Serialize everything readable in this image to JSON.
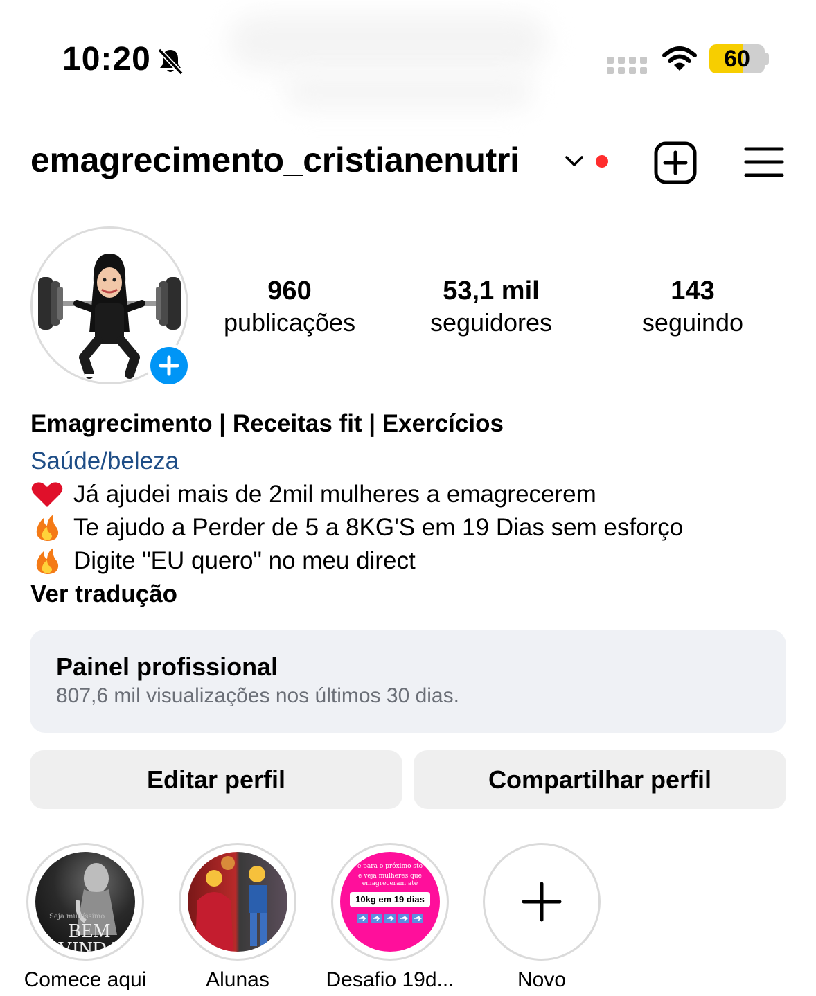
{
  "status_bar": {
    "time": "10:20",
    "battery_level": "60",
    "battery_fraction": 0.6
  },
  "header": {
    "username": "emagrecimento_cristianenutri",
    "notification_dot_color": "#ff2d2d"
  },
  "stats": [
    {
      "value": "960",
      "label": "publicações"
    },
    {
      "value": "53,1 mil",
      "label": "seguidores"
    },
    {
      "value": "143",
      "label": "seguindo"
    }
  ],
  "bio": {
    "name": "Emagrecimento | Receitas fit | Exercícios",
    "category": "Saúde/beleza",
    "lines": [
      {
        "emoji": "heart-icon",
        "text": "Já ajudei mais de 2mil mulheres a emagrecerem"
      },
      {
        "emoji": "fire-icon",
        "text": "Te ajudo a Perder de 5 a 8KG'S em 19 Dias sem esforço"
      },
      {
        "emoji": "fire-icon",
        "text": "Digite \"EU quero\" no meu direct"
      }
    ],
    "see_translation": "Ver tradução"
  },
  "dashboard": {
    "title": "Painel profissional",
    "subtitle": "807,6 mil visualizações nos últimos 30 dias."
  },
  "buttons": {
    "edit": "Editar perfil",
    "share": "Compartilhar perfil"
  },
  "highlights": [
    {
      "label": "Comece aqui",
      "cover_text_small": "Seja muitíssimo",
      "cover_text_big": "BEM VINDA"
    },
    {
      "label": "Alunas"
    },
    {
      "label": "Desafio 19d...",
      "cover_text_top": "e para o próximo sto",
      "cover_text_mid": "e veja mulheres que emagreceram até",
      "cover_badge": "10kg em 19 dias"
    },
    {
      "label": "Novo"
    }
  ],
  "colors": {
    "link_blue": "#1e4d86",
    "accent_blue": "#0095f6",
    "battery_yellow": "#f7ce00",
    "button_grey": "#efefef",
    "dashboard_bg": "#eff1f5",
    "highlight_pink": "#ff0f9b"
  }
}
